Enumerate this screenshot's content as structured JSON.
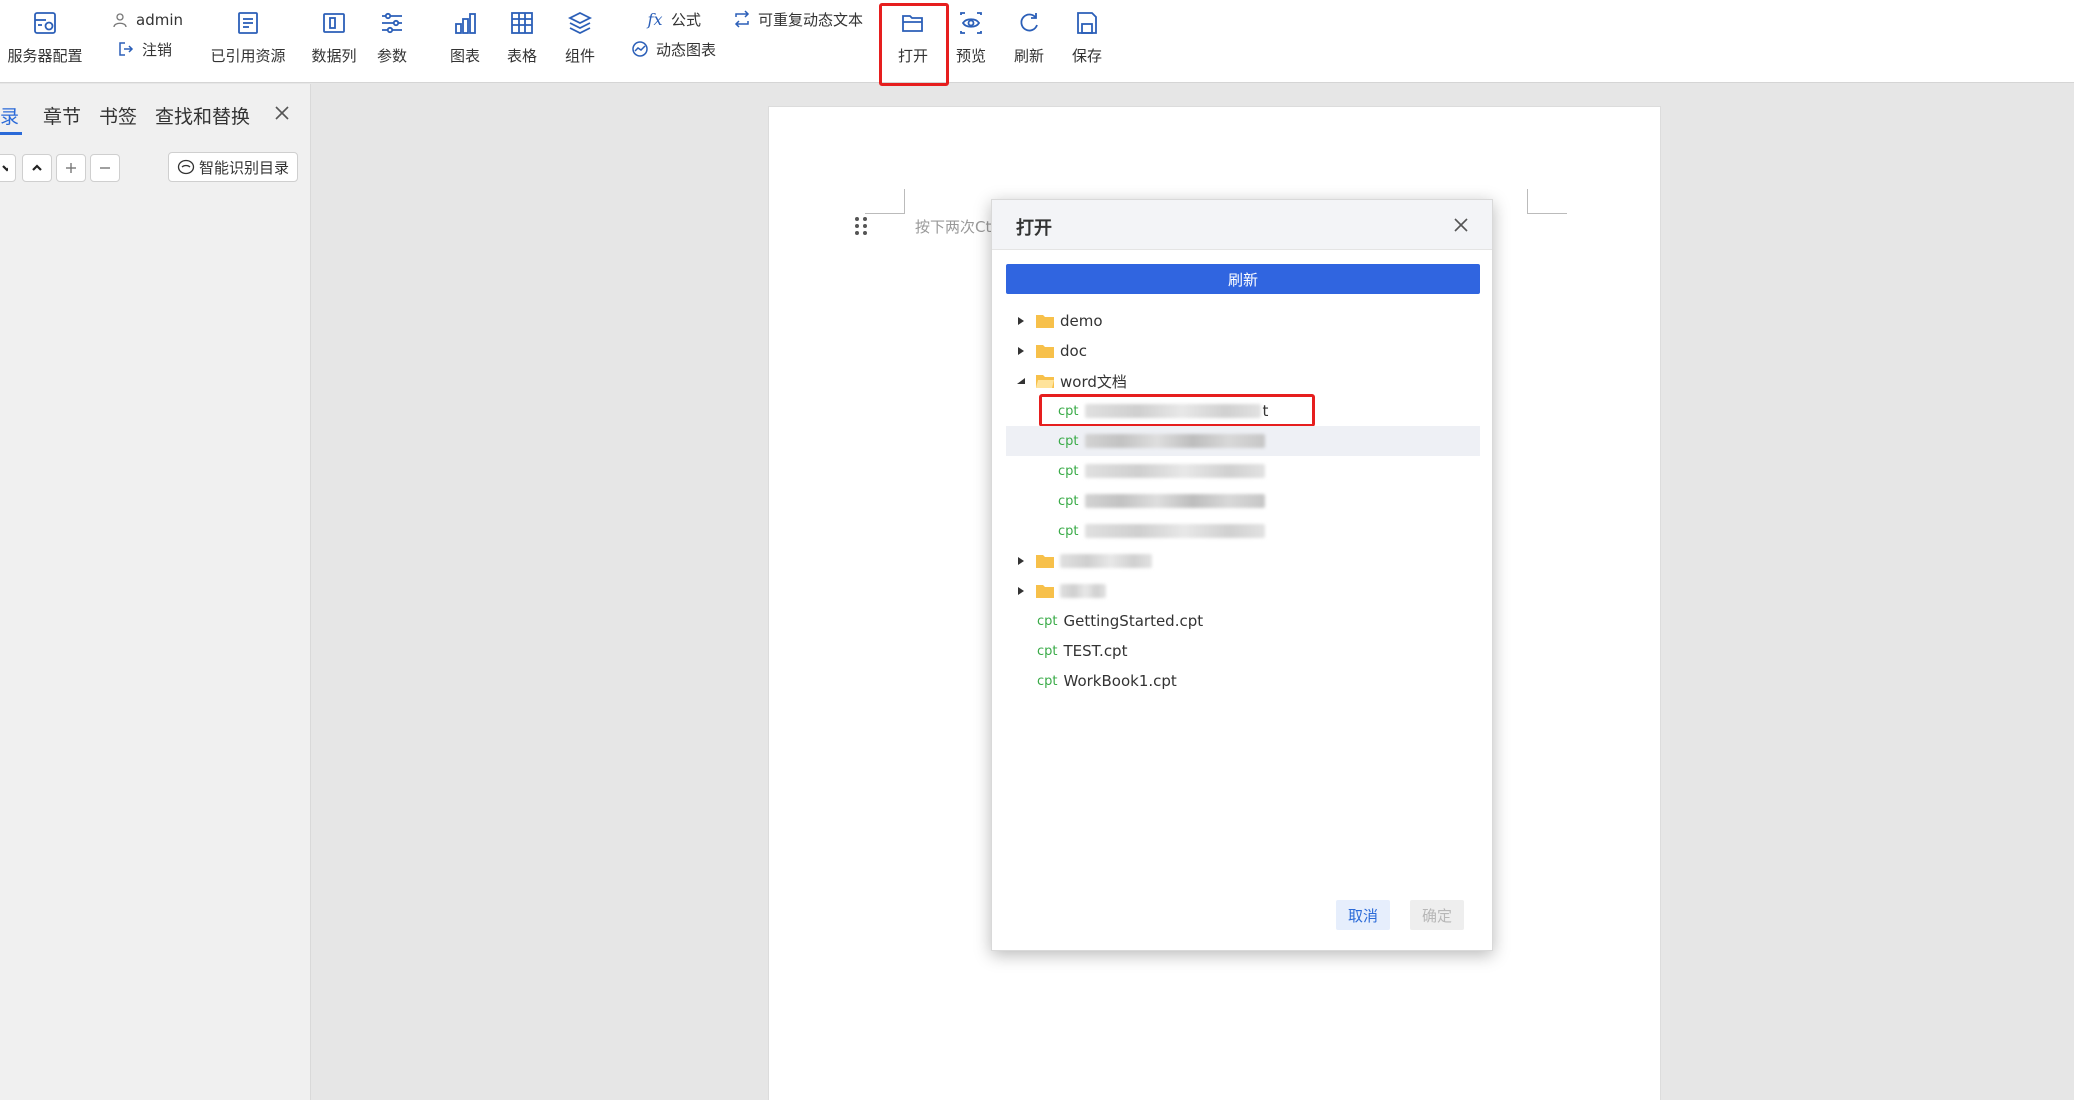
{
  "toolbar": {
    "server_config": "服务器配置",
    "user_name": "admin",
    "logout": "注销",
    "referenced_resources": "已引用资源",
    "data_column": "数据列",
    "params": "参数",
    "formula": "公式",
    "dynamic_chart": "动态图表",
    "repeat_dynamic_text": "可重复动态文本",
    "chart": "图表",
    "table": "表格",
    "component": "组件",
    "open": "打开",
    "preview": "预览",
    "refresh": "刷新",
    "save": "保存",
    "accent_color": "#2b6ad8",
    "highlight_color": "#e61e1e"
  },
  "left_panel": {
    "tabs": [
      "目录",
      "章节",
      "书签",
      "查找和替换"
    ],
    "active_tab": "目录",
    "tab_partial": "录",
    "smart_toc_button": "智能识别目录"
  },
  "document": {
    "placeholder": "按下两次Ct"
  },
  "dialog": {
    "title": "打开",
    "refresh_button": "刷新",
    "cpt_tag": "cpt",
    "tree": {
      "folder_demo": "demo",
      "folder_doc": "doc",
      "folder_word": "word文档",
      "file_partial_suffix": "t",
      "file_getting_started": "GettingStarted.cpt",
      "file_test": "TEST.cpt",
      "file_workbook": "WorkBook1.cpt"
    },
    "cancel_button": "取消",
    "ok_button": "确定"
  }
}
